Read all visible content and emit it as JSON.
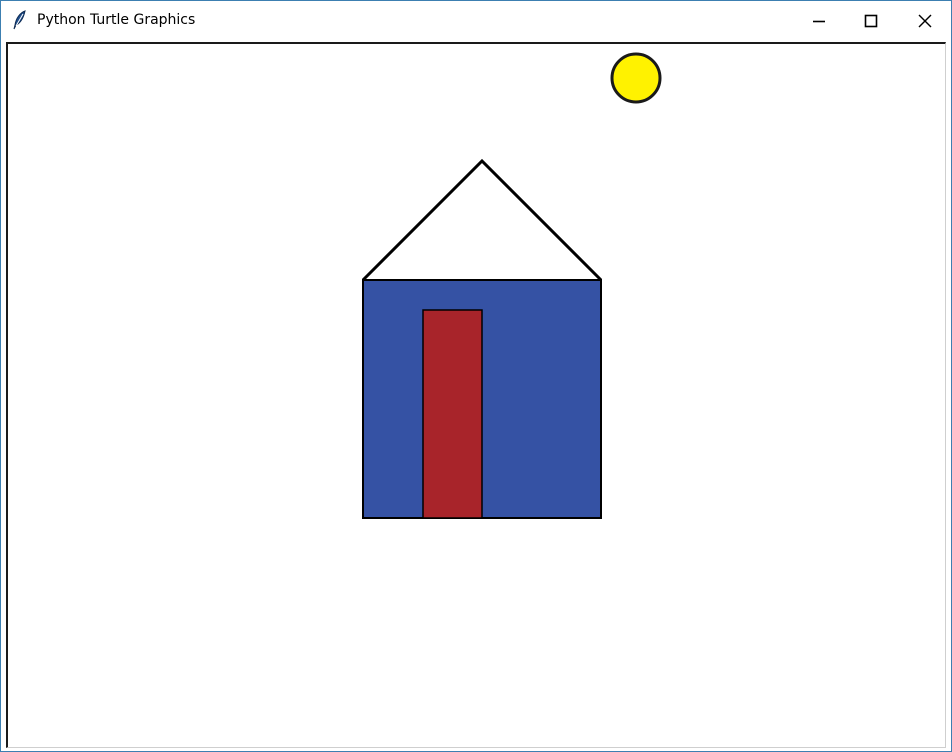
{
  "window": {
    "title": "Python Turtle Graphics",
    "app_icon": "feather-icon",
    "controls": {
      "minimize_icon": "minimize-icon",
      "maximize_icon": "maximize-icon",
      "close_icon": "close-icon"
    }
  },
  "drawing": {
    "background": "#ffffff",
    "sun": {
      "fill": "#fff200",
      "stroke": "#1a1a1a"
    },
    "roof": {
      "stroke": "#000000"
    },
    "house_body": {
      "fill": "#3552a4",
      "stroke": "#000000"
    },
    "door": {
      "fill": "#a8242a",
      "stroke": "#000000"
    }
  }
}
